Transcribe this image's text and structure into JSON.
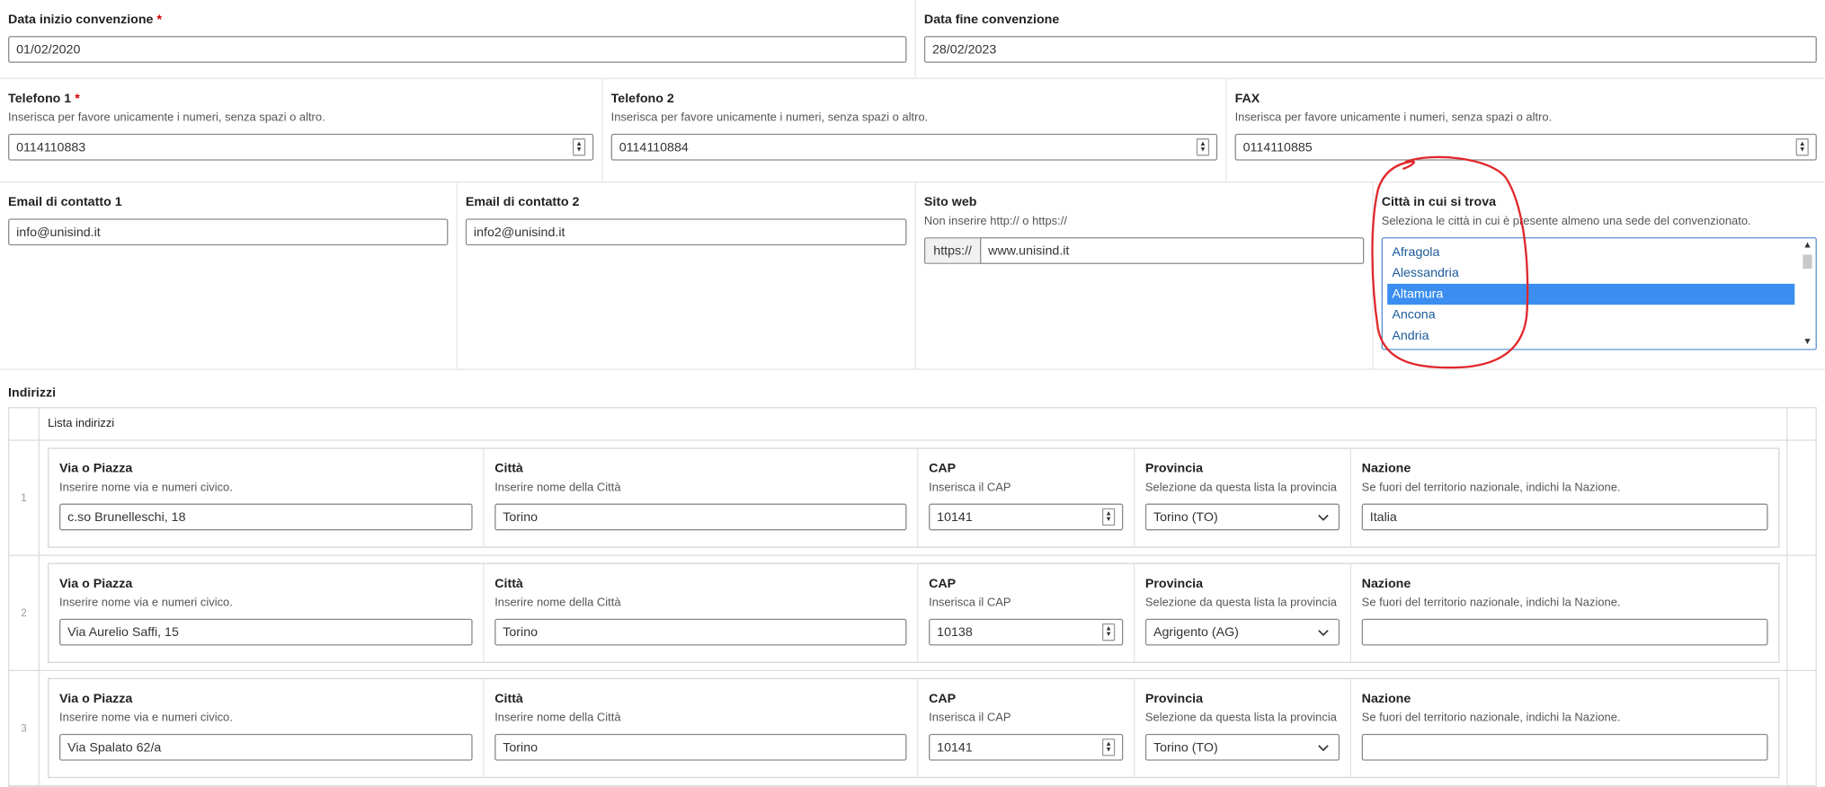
{
  "top": {
    "start": {
      "label": "Data inizio convenzione",
      "required": "*",
      "value": "01/02/2020"
    },
    "end": {
      "label": "Data fine convenzione",
      "value": "28/02/2023"
    }
  },
  "phones": [
    {
      "label": "Telefono 1",
      "required": "*",
      "hint": "Inserisca per favore unicamente i numeri, senza spazi o altro.",
      "value": "0114110883"
    },
    {
      "label": "Telefono 2",
      "hint": "Inserisca per favore unicamente i numeri, senza spazi o altro.",
      "value": "0114110884"
    },
    {
      "label": "FAX",
      "hint": "Inserisca per favore unicamente i numeri, senza spazi o altro.",
      "value": "0114110885"
    }
  ],
  "contacts": {
    "email1": {
      "label": "Email di contatto 1",
      "value": "info@unisind.it"
    },
    "email2": {
      "label": "Email di contatto 2",
      "value": "info2@unisind.it"
    },
    "site": {
      "label": "Sito web",
      "hint": "Non inserire http:// o https://",
      "prefix": "https://",
      "value": "www.unisind.it"
    },
    "cities": {
      "label": "Città in cui si trova",
      "hint": "Seleziona le città in cui è presente almeno una sede del convenzionato.",
      "options": [
        "Afragola",
        "Alessandria",
        "Altamura",
        "Ancona",
        "Andria"
      ],
      "selected": "Altamura"
    }
  },
  "addresses": {
    "title": "Indirizzi",
    "list_title": "Lista indirizzi",
    "labels": {
      "via": "Via o Piazza",
      "via_hint": "Inserire nome via e numeri civico.",
      "citta": "Città",
      "citta_hint": "Inserire nome della Città",
      "cap": "CAP",
      "cap_hint": "Inserisca il CAP",
      "prov": "Provincia",
      "prov_hint": "Selezione da questa lista la provincia",
      "naz": "Nazione",
      "naz_hint": "Se fuori del territorio nazionale, indichi la Nazione."
    },
    "rows": [
      {
        "index": "1",
        "via": "c.so Brunelleschi, 18",
        "citta": "Torino",
        "cap": "10141",
        "prov": "Torino (TO)",
        "naz": "Italia"
      },
      {
        "index": "2",
        "via": "Via Aurelio Saffi, 15",
        "citta": "Torino",
        "cap": "10138",
        "prov": "Agrigento (AG)",
        "naz": ""
      },
      {
        "index": "3",
        "via": "Via Spalato 62/a",
        "citta": "Torino",
        "cap": "10141",
        "prov": "Torino (TO)",
        "naz": ""
      }
    ]
  },
  "colors": {
    "selected": "#3b8ef0",
    "annotation": "#e0282b",
    "required": "#d00000"
  }
}
